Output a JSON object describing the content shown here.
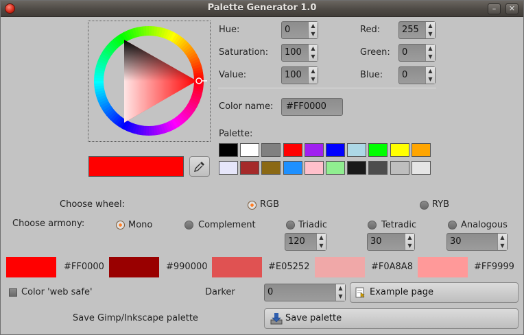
{
  "window": {
    "title": "Palette Generator 1.0",
    "minimize_glyph": "–",
    "close_glyph": "✕"
  },
  "picker": {
    "hue_label": "Hue:",
    "saturation_label": "Saturation:",
    "value_label": "Value:",
    "red_label": "Red:",
    "green_label": "Green:",
    "blue_label": "Blue:",
    "hue": "0",
    "saturation": "100",
    "value": "100",
    "red": "255",
    "green": "0",
    "blue": "0",
    "color_name_label": "Color name:",
    "color_name": "#FF0000",
    "current_color": "#FF0000",
    "eyedropper_icon": "eyedropper-icon"
  },
  "palette": {
    "label": "Palette:",
    "swatches": [
      "#000000",
      "#FFFFFF",
      "#808080",
      "#FF0000",
      "#A020F0",
      "#0000FF",
      "#ADD8E6",
      "#00FF00",
      "#FFFF00",
      "#FFA500",
      "#E6E6FA",
      "#A52A2A",
      "#8B6914",
      "#1E90FF",
      "#FFC0CB",
      "#90EE90",
      "#1A1A1A",
      "#4D4D4D",
      "#BEBEBE",
      "#E5E5E5"
    ]
  },
  "wheel": {
    "label": "Choose wheel:",
    "options": [
      "RGB",
      "RYB"
    ],
    "selected": "RGB"
  },
  "harmony": {
    "label": "Choose armony:",
    "options": [
      "Mono",
      "Complement",
      "Triadic",
      "Tetradic",
      "Analogous"
    ],
    "selected": "Mono",
    "triadic_value": "120",
    "tetradic_value": "30",
    "analogous_value": "30"
  },
  "generated": [
    {
      "hex": "#FF0000"
    },
    {
      "hex": "#990000"
    },
    {
      "hex": "#E05252"
    },
    {
      "hex": "#F0A8A8"
    },
    {
      "hex": "#FF9999"
    }
  ],
  "options": {
    "web_safe_label": "Color 'web safe'",
    "darker_label": "Darker",
    "darker_value": "0",
    "example_button": "Example page",
    "save_label": "Save Gimp/Inkscape palette",
    "save_button": "Save palette"
  }
}
